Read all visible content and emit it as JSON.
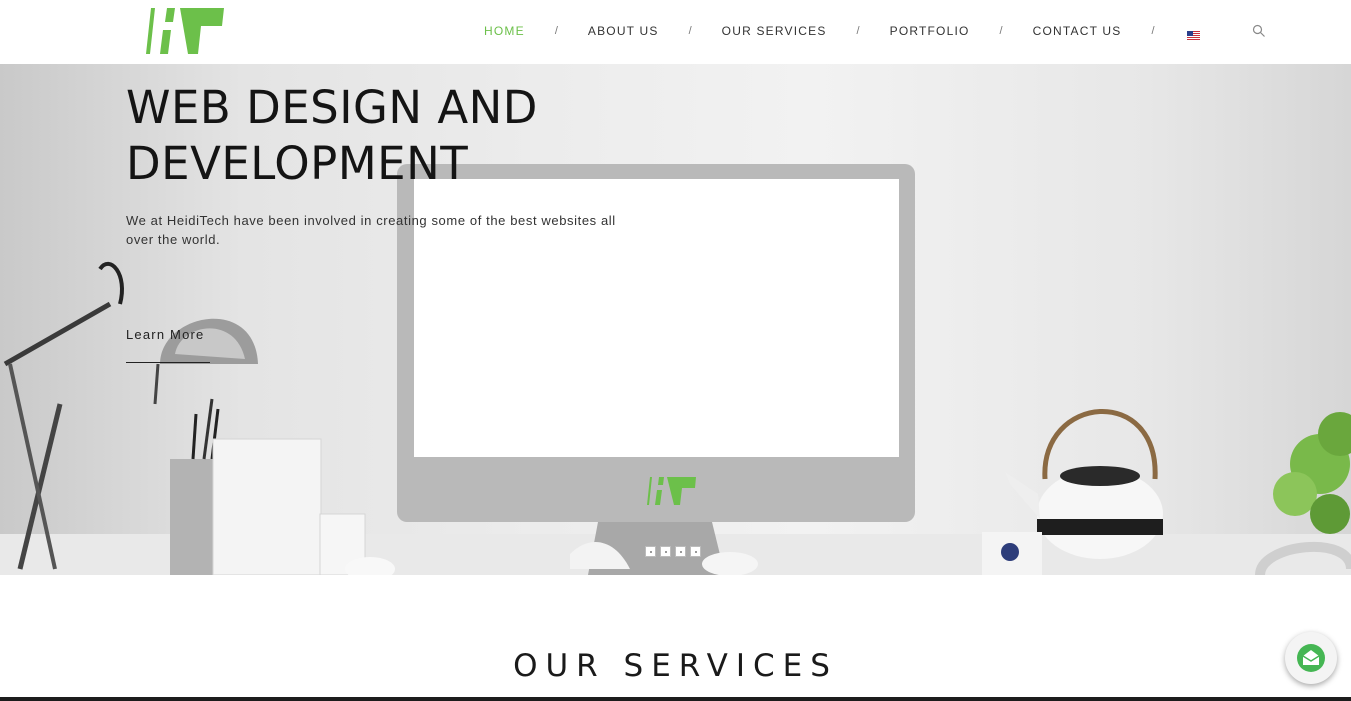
{
  "brand": {
    "logo_icon": "heiditech-logo",
    "accent_color": "#6cc04a"
  },
  "nav": {
    "items": [
      {
        "label": "HOME",
        "active": true
      },
      {
        "label": "ABOUT US",
        "active": false
      },
      {
        "label": "OUR SERVICES",
        "active": false
      },
      {
        "label": "PORTFOLIO",
        "active": false
      },
      {
        "label": "CONTACT US",
        "active": false
      }
    ],
    "separator": "/",
    "language_flag": "us-flag-icon",
    "search_icon": "search-icon"
  },
  "hero": {
    "title_line1": "WEB DESIGN AND",
    "title_line2": "DEVELOPMENT",
    "text": "We at HeidiTech have been involved in creating some of the best websites all over the world.",
    "cta_label": "Learn More",
    "slider_dots": 4
  },
  "services": {
    "title": "OUR SERVICES"
  },
  "floating_button": {
    "icon": "mail-icon"
  }
}
